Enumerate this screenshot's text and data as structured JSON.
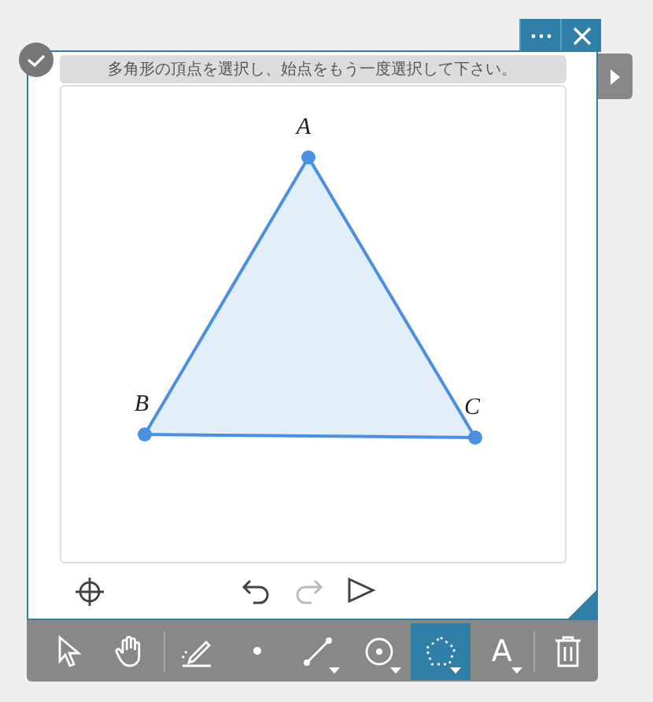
{
  "instruction": "多角形の頂点を選択し、始点をもう一度選択して下さい。",
  "polygon": {
    "points": [
      {
        "label": "A"
      },
      {
        "label": "B"
      },
      {
        "label": "C"
      }
    ]
  },
  "nav": [
    {
      "kind": "undo",
      "disabled": false
    },
    {
      "kind": "redo",
      "disabled": true
    },
    {
      "kind": "play",
      "disabled": false
    }
  ],
  "tools": [
    {
      "kind": "select",
      "selected": false,
      "has_menu": false
    },
    {
      "kind": "hand",
      "selected": false,
      "has_menu": false
    },
    {
      "kind": "pen",
      "selected": false,
      "has_menu": false
    },
    {
      "kind": "point",
      "selected": false,
      "has_menu": false
    },
    {
      "kind": "segment",
      "selected": false,
      "has_menu": true
    },
    {
      "kind": "circle",
      "selected": false,
      "has_menu": true
    },
    {
      "kind": "polygon",
      "selected": true,
      "has_menu": true
    },
    {
      "kind": "text",
      "label": "A",
      "selected": false,
      "has_menu": true
    },
    {
      "kind": "trash",
      "selected": false,
      "has_menu": false
    }
  ]
}
